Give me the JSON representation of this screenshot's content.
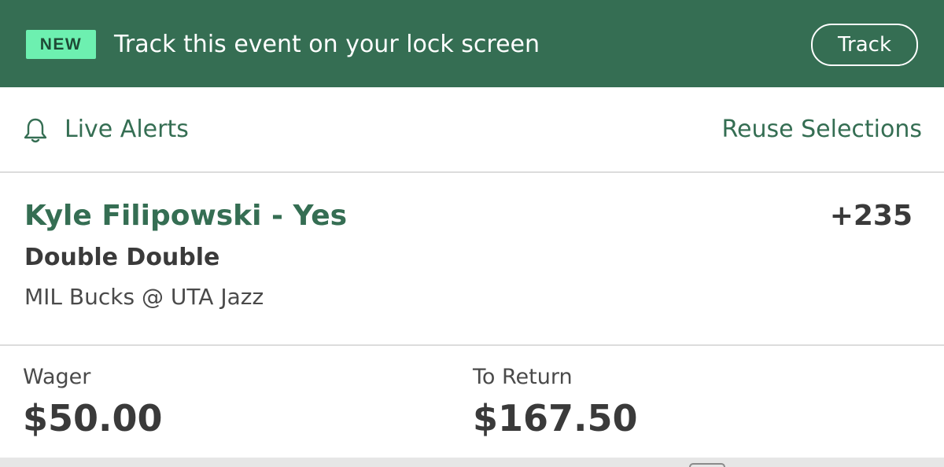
{
  "banner": {
    "badge": "NEW",
    "message": "Track this event on your lock screen",
    "track_label": "Track"
  },
  "alerts": {
    "icon": "bell-icon",
    "live_alerts_label": "Live Alerts",
    "reuse_label": "Reuse Selections"
  },
  "selection": {
    "name": "Kyle Filipowski - Yes",
    "odds": "+235",
    "market": "Double Double",
    "event": "MIL Bucks @ UTA Jazz"
  },
  "bet": {
    "wager_label": "Wager",
    "wager_amount": "$50.00",
    "return_label": "To Return",
    "return_amount": "$167.50"
  },
  "colors": {
    "brand_green": "#356e53",
    "badge_mint": "#6df0b0",
    "text_dark": "#3a3a3a",
    "divider": "#dcdcdc"
  }
}
